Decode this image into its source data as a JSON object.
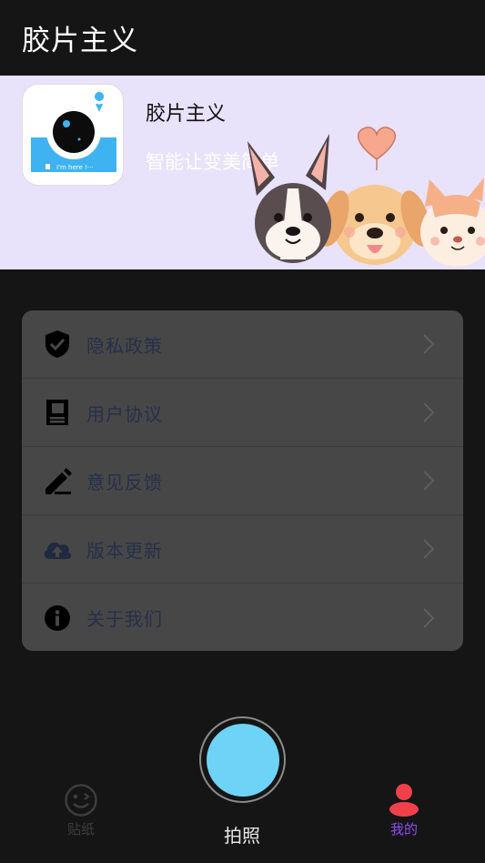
{
  "header": {
    "title": "胶片主义"
  },
  "banner": {
    "app_name": "胶片主义",
    "slogan": "智能让变美简单",
    "logo_caption": "I'm here !···"
  },
  "menu": {
    "items": [
      {
        "label": "隐私政策",
        "icon": "shield-check-icon"
      },
      {
        "label": "用户协议",
        "icon": "document-icon"
      },
      {
        "label": "意见反馈",
        "icon": "pencil-icon"
      },
      {
        "label": "版本更新",
        "icon": "cloud-upload-icon"
      },
      {
        "label": "关于我们",
        "icon": "info-icon"
      }
    ]
  },
  "tabbar": {
    "stickers_label": "贴纸",
    "shutter_label": "拍照",
    "mine_label": "我的"
  },
  "colors": {
    "background": "#151515",
    "banner": "#e9e2fb",
    "card": "#474747",
    "accent": "#8e4cf0",
    "shutter": "#6ed3f7",
    "avatar": "#f0414a"
  }
}
